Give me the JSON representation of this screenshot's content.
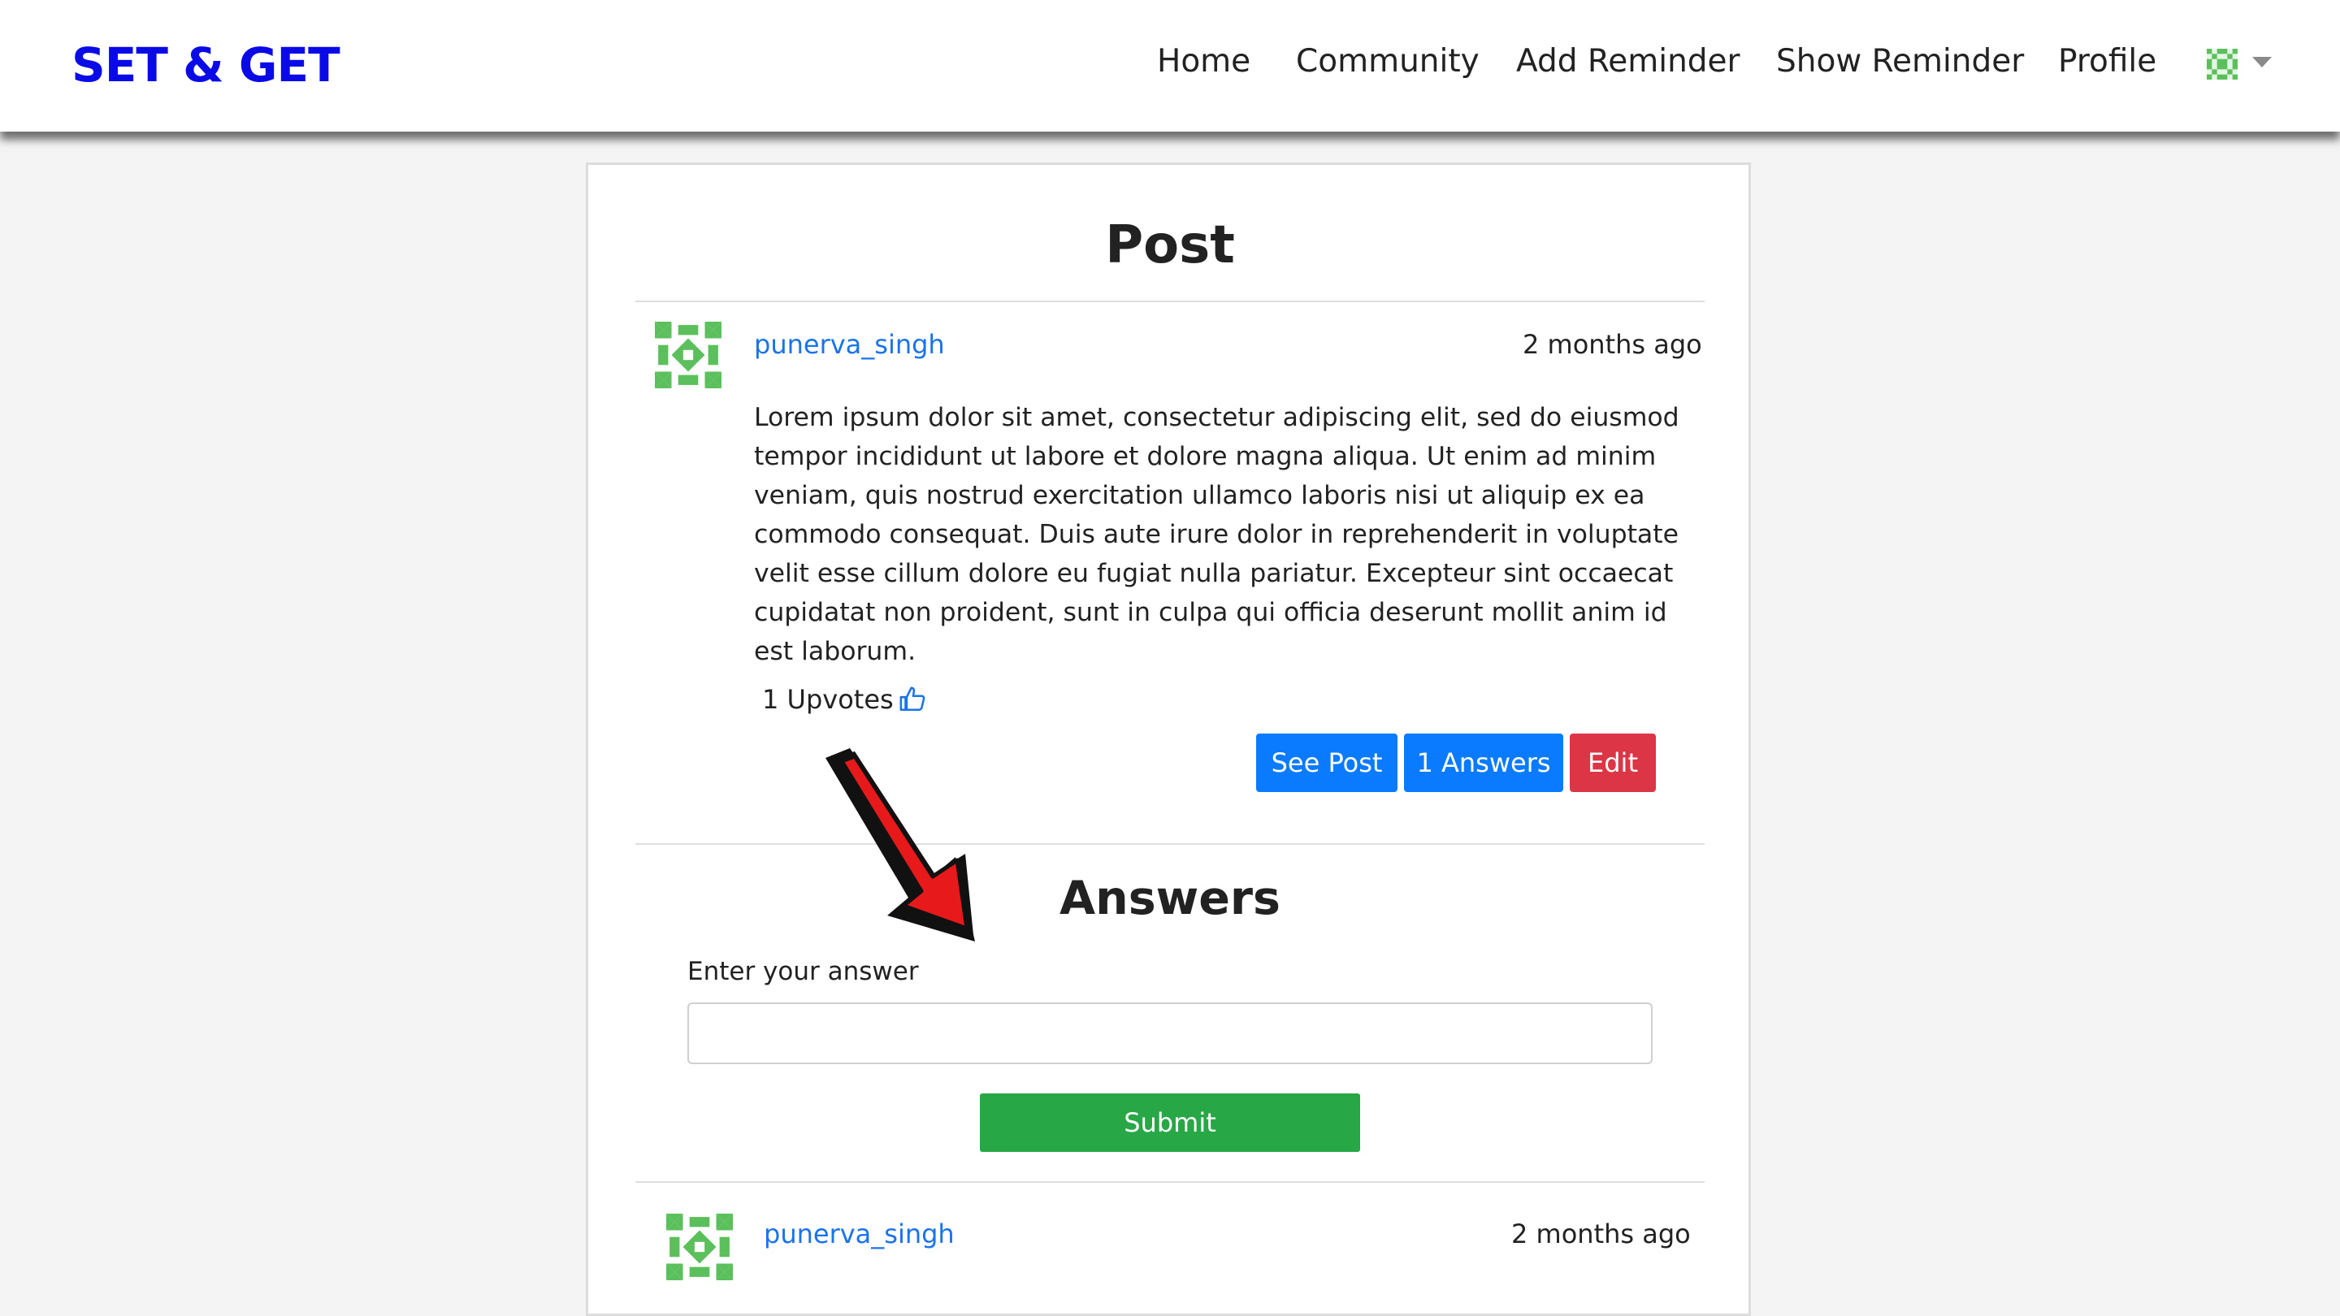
{
  "navbar": {
    "brand": "SET & GET",
    "items": [
      "Home",
      "Community",
      "Add Reminder",
      "Show Reminder",
      "Profile"
    ],
    "avatar_icon": "identicon-avatar",
    "dropdown_icon": "caret-down-icon"
  },
  "page": {
    "title": "Post"
  },
  "post": {
    "username": "punerva_singh",
    "timestamp": "2 months ago",
    "body": "Lorem ipsum dolor sit amet, consectetur adipiscing elit, sed do eiusmod tempor incididunt ut labore et dolore magna aliqua. Ut enim ad minim veniam, quis nostrud exercitation ullamco laboris nisi ut aliquip ex ea commodo consequat. Duis aute irure dolor in reprehenderit in voluptate velit esse cillum dolore eu fugiat nulla pariatur. Excepteur sint occaecat cupidatat non proident, sunt in culpa qui officia deserunt mollit anim id est laborum.",
    "upvotes_label": "1 Upvotes",
    "upvote_icon": "thumbs-up-icon",
    "buttons": {
      "see_post": "See Post",
      "answers": "1 Answers",
      "edit": "Edit"
    }
  },
  "answers": {
    "title": "Answers",
    "input_label": "Enter your answer",
    "input_value": "",
    "submit": "Submit",
    "items": [
      {
        "username": "punerva_singh",
        "timestamp": "2 months ago"
      }
    ]
  },
  "colors": {
    "brand": "#0a0ae6",
    "link": "#1a73e8",
    "primary": "#0a7bff",
    "danger": "#dc3545",
    "success": "#27a745",
    "identicon": "#5bc05b",
    "annotation_arrow": "#e8191a"
  }
}
